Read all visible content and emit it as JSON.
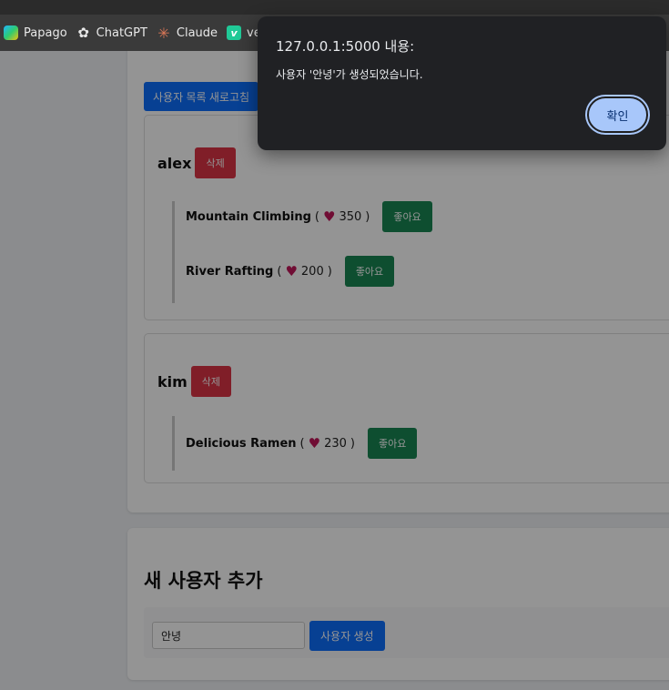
{
  "bookmarks": [
    {
      "label": "Papago",
      "icon": "papago-icon"
    },
    {
      "label": "ChatGPT",
      "icon": "chatgpt-icon"
    },
    {
      "label": "Claude",
      "icon": "claude-icon"
    },
    {
      "label": "velo",
      "icon": "velog-icon"
    }
  ],
  "users_section": {
    "refresh_label": "사용자 목록 새로고침",
    "users": [
      {
        "name": "alex",
        "delete_label": "삭제",
        "hobbies": [
          {
            "name": "Mountain Climbing",
            "likes": "350",
            "like_label": "좋아요"
          },
          {
            "name": "River Rafting",
            "likes": "200",
            "like_label": "좋아요"
          }
        ]
      },
      {
        "name": "kim",
        "delete_label": "삭제",
        "hobbies": [
          {
            "name": "Delicious Ramen",
            "likes": "230",
            "like_label": "좋아요"
          }
        ]
      }
    ]
  },
  "add_section": {
    "title": "새 사용자 추가",
    "input_value": "안녕",
    "create_label": "사용자 생성"
  },
  "dialog": {
    "title": "127.0.0.1:5000 내용:",
    "message": "사용자 '안녕'가 생성되었습니다.",
    "ok_label": "확인"
  }
}
